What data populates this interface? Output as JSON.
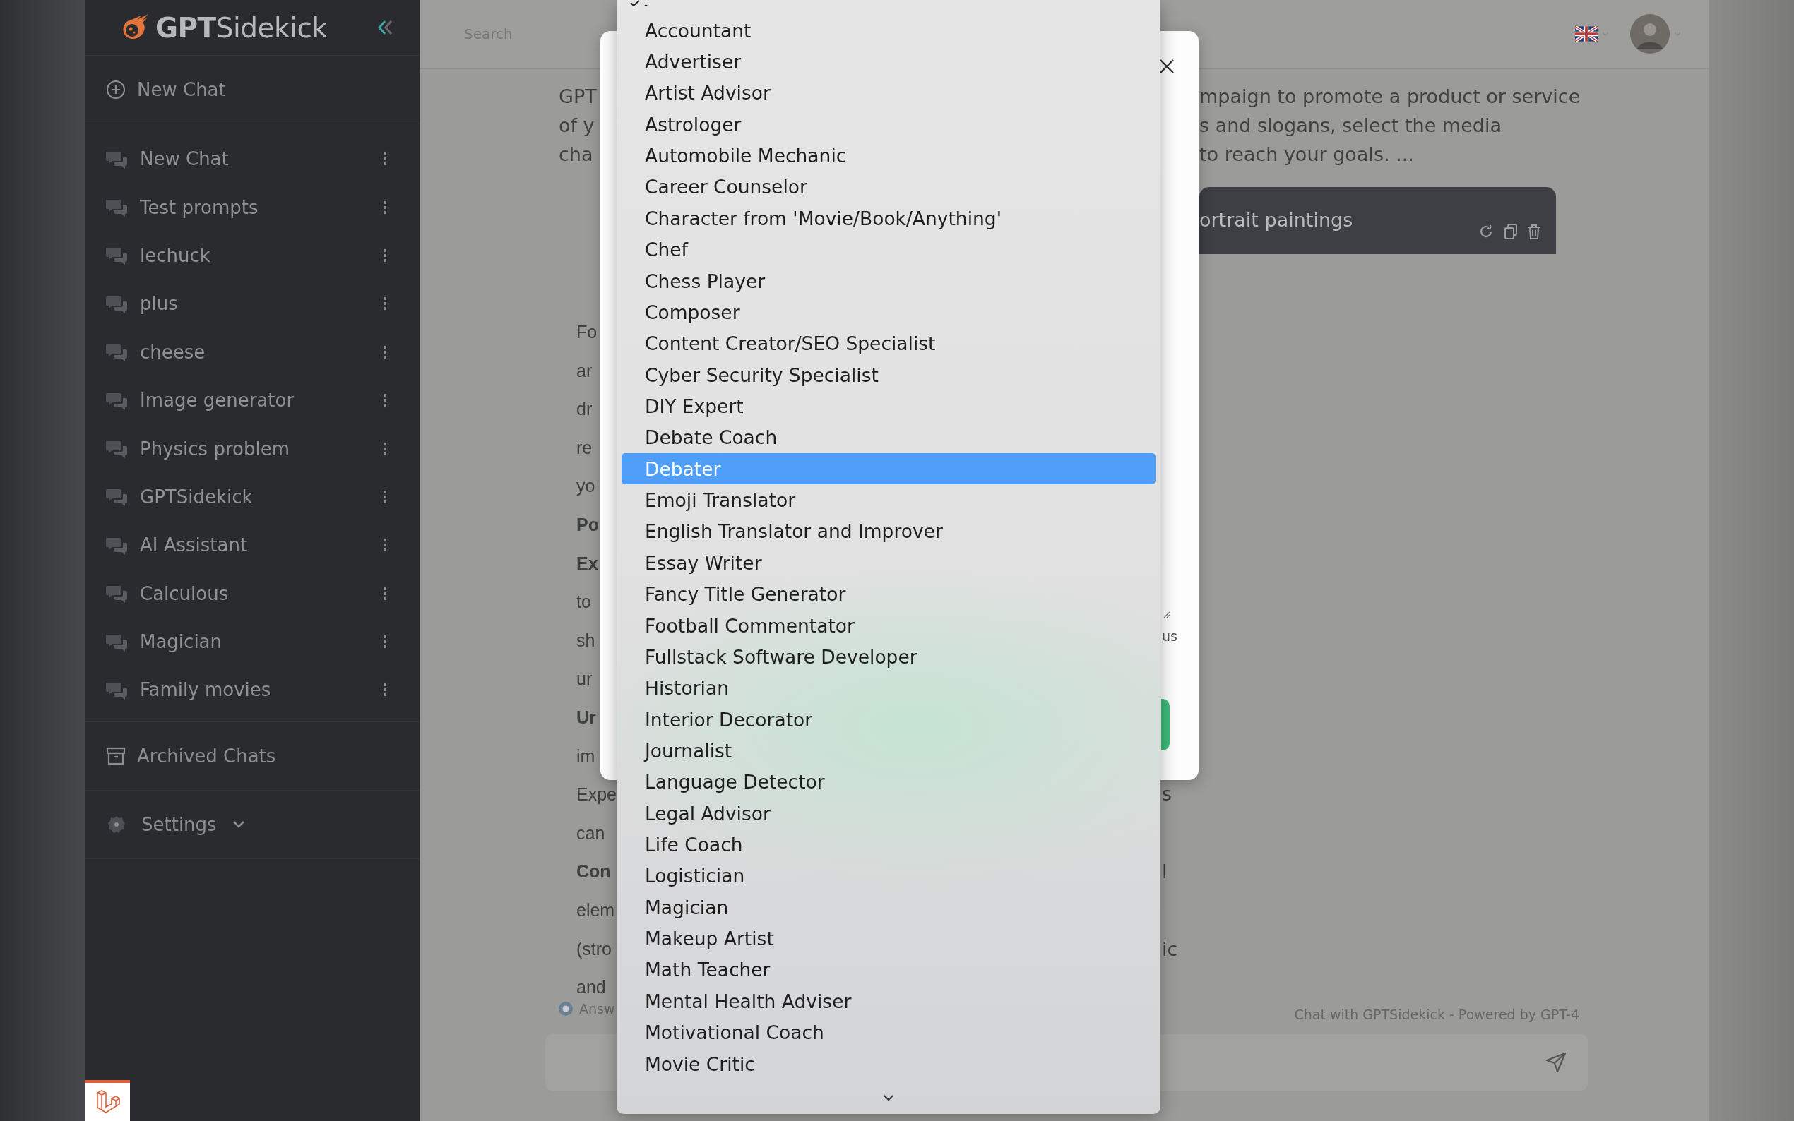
{
  "sidebar": {
    "logo_bold": "GPT",
    "logo_rest": "Sidekick",
    "new_chat": "New Chat",
    "chats": [
      {
        "title": "New Chat"
      },
      {
        "title": "Test prompts"
      },
      {
        "title": "lechuck"
      },
      {
        "title": "plus"
      },
      {
        "title": "cheese"
      },
      {
        "title": "Image generator"
      },
      {
        "title": "Physics problem"
      },
      {
        "title": "GPTSidekick"
      },
      {
        "title": "AI Assistant"
      },
      {
        "title": "Calculous"
      },
      {
        "title": "Magician"
      },
      {
        "title": "Family movies"
      }
    ],
    "archived": "Archived Chats",
    "settings": "Settings"
  },
  "topbar": {
    "search_placeholder": "Search"
  },
  "chat": {
    "intro_left": [
      "GPT",
      "of y",
      "cha"
    ],
    "intro_right": [
      "mpaign to promote a product or service",
      "s and slogans, select the media",
      "to reach your goals. ..."
    ],
    "bubble": "ortrait paintings",
    "answer_left": [
      {
        "text": "Fo",
        "bold": false
      },
      {
        "text": "ar",
        "bold": false
      },
      {
        "text": "dr",
        "bold": false
      },
      {
        "text": "re",
        "bold": false
      },
      {
        "text": "yo",
        "bold": false
      },
      {
        "text": "Po",
        "bold": true
      },
      {
        "text": "Ex",
        "bold": true
      },
      {
        "text": "to",
        "bold": false
      },
      {
        "text": "sh",
        "bold": false
      },
      {
        "text": "ur",
        "bold": false
      },
      {
        "text": "Ur",
        "bold": true
      },
      {
        "text": "im",
        "bold": false
      },
      {
        "text": "Expe",
        "bold": false
      },
      {
        "text": "can",
        "bold": false
      },
      {
        "text": "Con",
        "bold": true
      },
      {
        "text": "elem",
        "bold": false
      },
      {
        "text": "(stro",
        "bold": false
      },
      {
        "text": "and",
        "bold": false
      }
    ],
    "answer_right": [
      "s",
      "l",
      "ic"
    ],
    "answer_option": "Answ",
    "footer": "Chat with GPTSidekick - Powered by GPT-4"
  },
  "dialog": {
    "link": "us"
  },
  "dropdown": {
    "options": [
      {
        "label": "-",
        "checked": true,
        "selected": false
      },
      {
        "label": "Accountant",
        "checked": false,
        "selected": false
      },
      {
        "label": "Advertiser",
        "checked": false,
        "selected": false
      },
      {
        "label": "Artist Advisor",
        "checked": false,
        "selected": false
      },
      {
        "label": "Astrologer",
        "checked": false,
        "selected": false
      },
      {
        "label": "Automobile Mechanic",
        "checked": false,
        "selected": false
      },
      {
        "label": "Career Counselor",
        "checked": false,
        "selected": false
      },
      {
        "label": "Character from 'Movie/Book/Anything'",
        "checked": false,
        "selected": false
      },
      {
        "label": "Chef",
        "checked": false,
        "selected": false
      },
      {
        "label": "Chess Player",
        "checked": false,
        "selected": false
      },
      {
        "label": "Composer",
        "checked": false,
        "selected": false
      },
      {
        "label": "Content Creator/SEO Specialist",
        "checked": false,
        "selected": false
      },
      {
        "label": "Cyber Security Specialist",
        "checked": false,
        "selected": false
      },
      {
        "label": "DIY Expert",
        "checked": false,
        "selected": false
      },
      {
        "label": "Debate Coach",
        "checked": false,
        "selected": false
      },
      {
        "label": "Debater",
        "checked": false,
        "selected": true
      },
      {
        "label": "Emoji Translator",
        "checked": false,
        "selected": false
      },
      {
        "label": "English Translator and Improver",
        "checked": false,
        "selected": false
      },
      {
        "label": "Essay Writer",
        "checked": false,
        "selected": false
      },
      {
        "label": "Fancy Title Generator",
        "checked": false,
        "selected": false
      },
      {
        "label": "Football Commentator",
        "checked": false,
        "selected": false
      },
      {
        "label": "Fullstack Software Developer",
        "checked": false,
        "selected": false
      },
      {
        "label": "Historian",
        "checked": false,
        "selected": false
      },
      {
        "label": "Interior Decorator",
        "checked": false,
        "selected": false
      },
      {
        "label": "Journalist",
        "checked": false,
        "selected": false
      },
      {
        "label": "Language Detector",
        "checked": false,
        "selected": false
      },
      {
        "label": "Legal Advisor",
        "checked": false,
        "selected": false
      },
      {
        "label": "Life Coach",
        "checked": false,
        "selected": false
      },
      {
        "label": "Logistician",
        "checked": false,
        "selected": false
      },
      {
        "label": "Magician",
        "checked": false,
        "selected": false
      },
      {
        "label": "Makeup Artist",
        "checked": false,
        "selected": false
      },
      {
        "label": "Math Teacher",
        "checked": false,
        "selected": false
      },
      {
        "label": "Mental Health Adviser",
        "checked": false,
        "selected": false
      },
      {
        "label": "Motivational Coach",
        "checked": false,
        "selected": false
      },
      {
        "label": "Movie Critic",
        "checked": false,
        "selected": false
      }
    ]
  }
}
